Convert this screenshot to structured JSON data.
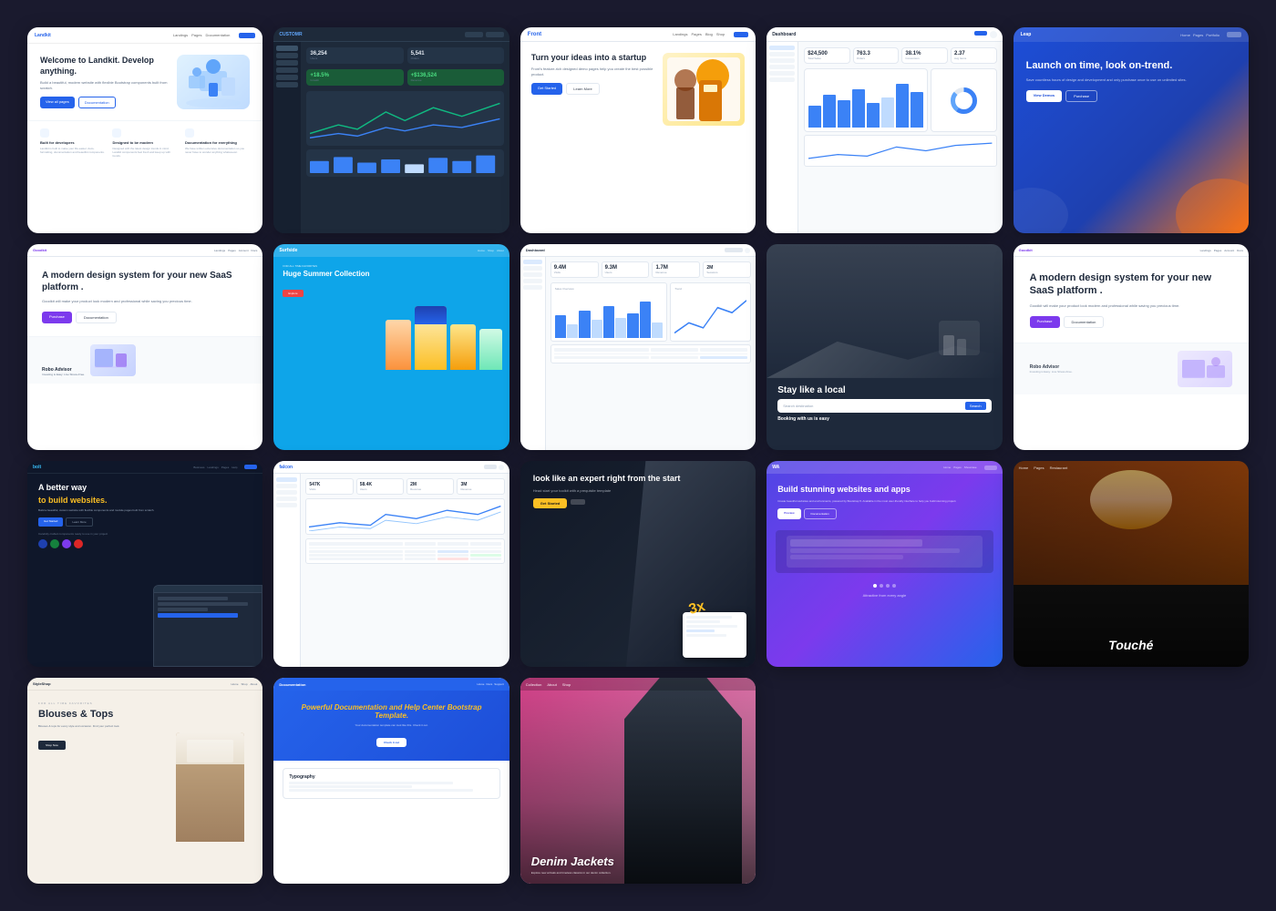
{
  "cards": [
    {
      "id": "landkit",
      "title": "Welcome to Landkit. Develop anything.",
      "subtitle": "Build a beautiful, modern website with flexible Bootstrap components built from scratch.",
      "nav_logo": "Landkit",
      "btn1": "View all pages",
      "btn2": "Documentation",
      "features": [
        {
          "title": "Built for developers",
          "desc": "Landkit is built to make your life easier. Auto-formatting, documentation and beautiful components."
        },
        {
          "title": "Designed to be modern",
          "desc": "Designed with the latest design trends in mind. Landkit components feel fresh and keep up with trends."
        },
        {
          "title": "Documentation for everything",
          "desc": "We have written extensive documentation so you never have to wonder anything whatsoever."
        }
      ]
    },
    {
      "id": "analytics",
      "logo": "CUSTOMR",
      "stats": [
        {
          "value": "36,254",
          "label": "Users"
        },
        {
          "value": "5,541",
          "label": "Orders"
        },
        {
          "value": "+18.5%",
          "label": "Growth"
        },
        {
          "value": "+$136,524",
          "label": "Revenue"
        }
      ]
    },
    {
      "id": "front",
      "nav_brand": "Front",
      "title": "Turn your ideas into a startup",
      "subtitle": "Front's feature-rich designed demo pages help you create the best possible product.",
      "btn1": "Get Started",
      "btn2": "Learn More"
    },
    {
      "id": "dashboard",
      "title": "Dashboard",
      "kpis": [
        {
          "value": "$24,500",
          "label": "Total Sales"
        },
        {
          "value": "763.3",
          "label": "Orders"
        },
        {
          "value": "38.1%",
          "label": "Conversion"
        },
        {
          "value": "2.37",
          "label": "Avg Items"
        }
      ]
    },
    {
      "id": "leap",
      "title": "Launch on time, look on-trend.",
      "subtitle": "Save countless hours of design and development and only purchase once to use on unlimited sites.",
      "btn1": "View Demos",
      "btn2": "Purchase"
    },
    {
      "id": "goodkit",
      "nav_logo": "Goodkit",
      "title": "A modern design system for your new SaaS platform .",
      "subtitle": "Goodkit will make your product look modern and professional while saving you precious time.",
      "btn1": "Purchase",
      "btn2": "Documentation",
      "robo_title": "Robo Advisor",
      "robo_sub": "Investing is Easy: Live Stress-Free."
    },
    {
      "id": "summer",
      "tag": "FOR ALL TIME FAVORITES",
      "title": "Huge Summer Collection",
      "subtitle": "The most trendy pieces",
      "btn": "Explore"
    },
    {
      "id": "analytics2",
      "stats": [
        {
          "value": "9.4M",
          "label": "Visits"
        },
        {
          "value": "9.3M",
          "label": "Users"
        },
        {
          "value": "1.7M",
          "label": "Revenue"
        }
      ]
    },
    {
      "id": "local",
      "title": "Stay like a local",
      "subtitle": "Booking with us is easy",
      "search_placeholder": "Search destination",
      "search_btn": "Search"
    },
    {
      "id": "goodkit-lg",
      "title": "A modern design system for your new SaaS platform .",
      "subtitle": "Goodkit will make your product look modern and professional while saving you precious time.",
      "btn1": "Purchase",
      "btn2": "Documentation",
      "robo_title": "Robo Advisor",
      "robo_sub": "Investing is Easy: Live Stress-Free."
    },
    {
      "id": "bolt",
      "nav_brand": "bolt",
      "title": "A better way",
      "subtitle": "to build websites.",
      "title2": "A better way",
      "subtitle2": "to build websites.",
      "desc": "Build a beautiful, custom website with flexible components and module pages built from scratch.",
      "btn1": "Get Started",
      "btn2": "Learn More",
      "features_text": "Carefully crafted components ready to use in your project"
    },
    {
      "id": "falcon",
      "stats": [
        {
          "value": "547K",
          "label": "Visits"
        },
        {
          "value": "58.4K",
          "label": "Users"
        },
        {
          "value": "2M",
          "label": "Revenue"
        }
      ]
    },
    {
      "id": "expert",
      "title": "look like an expert right from the start",
      "subtitle": "Head start your toolkit with a prequisite template",
      "btn": "Get Started",
      "number": "3x"
    },
    {
      "id": "wa",
      "title": "Build stunning websites and apps",
      "subtitle": "Create beautiful websites and environments, powered by Bootstrap 5. Available in the most user-friendly interface to help you build stunning project.",
      "btn1": "Preview",
      "btn2": "Documentation",
      "sub_label": "Attractive from every angle"
    },
    {
      "id": "touche",
      "title": "Touché",
      "nav_items": [
        "Home",
        "Pages",
        "Restaurant"
      ]
    },
    {
      "id": "blouses",
      "tag": "FOR ALL TIME FAVORITES",
      "title": "Blouses & Tops",
      "subtitle": "Blouses & tops for every style and occasion. Find your perfect look.",
      "btn": "Shop Now"
    },
    {
      "id": "docs",
      "nav_brand": "Documentation",
      "title": "Powerful Documentation and Help Center Bootstrap Template.",
      "title_highlight": "Documentation",
      "subtitle": "Your documentation template can look like this. Check it out.",
      "btn": "Check it out",
      "typography_label": "Typography"
    },
    {
      "id": "denim",
      "title": "Denim Jackets",
      "subtitle": "Explore new arrivals and timeless classics in our denim collection.",
      "nav_items": [
        "Collection",
        "About",
        "Shop"
      ]
    }
  ],
  "colors": {
    "primary_blue": "#2563eb",
    "primary_purple": "#7c3aed",
    "dark": "#1e293b",
    "accent_yellow": "#fbbf24",
    "accent_orange": "#f97316",
    "light_bg": "#f8fafc"
  }
}
